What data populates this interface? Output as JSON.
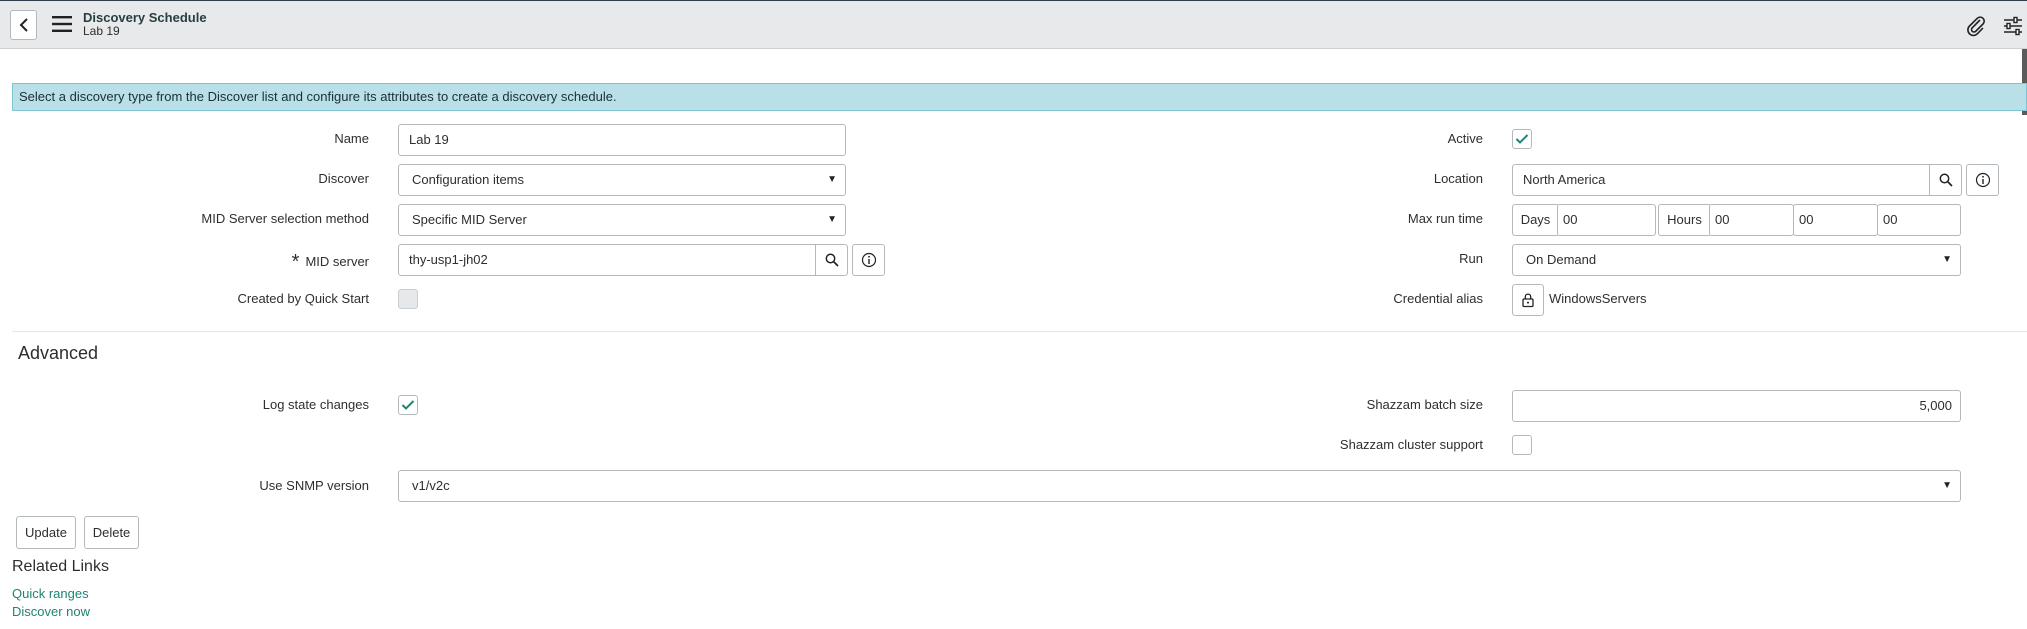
{
  "header": {
    "title": "Discovery Schedule",
    "subtitle": "Lab 19"
  },
  "info_message": "Select a discovery type from the Discover list and configure its attributes to create a discovery schedule.",
  "form": {
    "name": {
      "label": "Name",
      "value": "Lab 19"
    },
    "discover": {
      "label": "Discover",
      "value": "Configuration items"
    },
    "mid_selection": {
      "label": "MID Server selection method",
      "value": "Specific MID Server"
    },
    "mid_server": {
      "label": "MID server",
      "required_mark": "*",
      "value": "thy-usp1-jh02"
    },
    "created_by_quick_start": {
      "label": "Created by Quick Start",
      "checked": false,
      "disabled": true
    },
    "active": {
      "label": "Active",
      "checked": true
    },
    "location": {
      "label": "Location",
      "value": "North America"
    },
    "max_run_time": {
      "label": "Max run time",
      "days_label": "Days",
      "days": "00",
      "hours_label": "Hours",
      "hours": "00",
      "minutes": "00",
      "seconds": "00"
    },
    "run": {
      "label": "Run",
      "value": "On Demand"
    },
    "credential_alias": {
      "label": "Credential alias",
      "value": "WindowsServers"
    }
  },
  "advanced": {
    "title": "Advanced",
    "log_state_changes": {
      "label": "Log state changes",
      "checked": true
    },
    "shazzam_batch_size": {
      "label": "Shazzam batch size",
      "value": "5,000"
    },
    "shazzam_cluster_support": {
      "label": "Shazzam cluster support",
      "checked": false
    },
    "snmp_version": {
      "label": "Use SNMP version",
      "value": "v1/v2c"
    }
  },
  "buttons": {
    "update": "Update",
    "delete": "Delete"
  },
  "related_links": {
    "title": "Related Links",
    "items": [
      "Quick ranges",
      "Discover now"
    ]
  },
  "colors": {
    "info_bg": "#b9dfe7",
    "link": "#1f8476",
    "check": "#1f8476",
    "header_bg": "#e7e9eb"
  }
}
